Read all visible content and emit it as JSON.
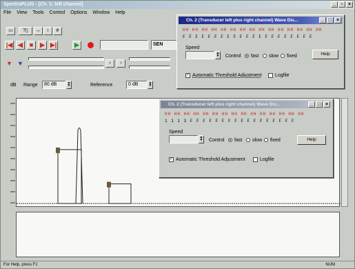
{
  "main": {
    "title": "SpectraPLUS - [Ch. 1: left channel]",
    "menu": [
      "File",
      "View",
      "Tools",
      "Control",
      "Options",
      "Window",
      "Help"
    ],
    "toolbar_extra": "SEN",
    "range_label": "dB",
    "range_field_label": "Range",
    "range_value": "80 dB",
    "reference_label": "Reference",
    "reference_value": "0 dB",
    "status_left": "For Help, press F1",
    "status_right": "NUM"
  },
  "chart_data": {
    "type": "bar",
    "title": "",
    "xlabel": "",
    "ylabel": "",
    "series": [
      {
        "values": [
          0.55,
          0.8,
          0.2
        ]
      }
    ]
  },
  "dialog_1": {
    "title": "Ch. 2 (Transducer left plus right channel) Wave Dis...",
    "ticker_row": "HH HH HH HH HH HH HH HH HH HH HH HH HH HH HH",
    "ticker_values": "F F F F   F F F F F   F F F F F F   F F F F F F",
    "speed_label": "Speed",
    "control_label": "Control",
    "radio_fast": "fast",
    "radio_slow": "slow",
    "radio_fixed": "fixed",
    "help_button": "Help",
    "auto_threshold_label": "Automatic Threshold Adjustment",
    "logfile_label": "Logfile"
  },
  "dialog_2": {
    "title": "Ch. 2 (Transducer left plus right channel) Wave Dis...",
    "ticker_row": "HH HH HH HH HH HH HH HH HH HH HH HH HH HH HH",
    "ticker_values": "1 1 1 3   F F F F F   F F F F F F   F F F F F F",
    "speed_label": "Speed",
    "control_label": "Control",
    "radio_fast": "fast",
    "radio_slow": "slow",
    "radio_fixed": "fixed",
    "help_button": "Help",
    "auto_threshold_label": "Automatic Threshold Adjustment",
    "logfile_label": "Logfile"
  },
  "colors": {
    "desktop": "#6f8aa3",
    "window_face": "#c9cdc7",
    "active_title": "#1c2a85",
    "record_red": "#e0181d",
    "play_green": "#1f9a2e"
  },
  "icons": [
    "open-file-icon",
    "print-icon",
    "zoom-icon",
    "stop-icon",
    "play-icon",
    "record-icon",
    "rewind-icon",
    "forward-icon"
  ]
}
